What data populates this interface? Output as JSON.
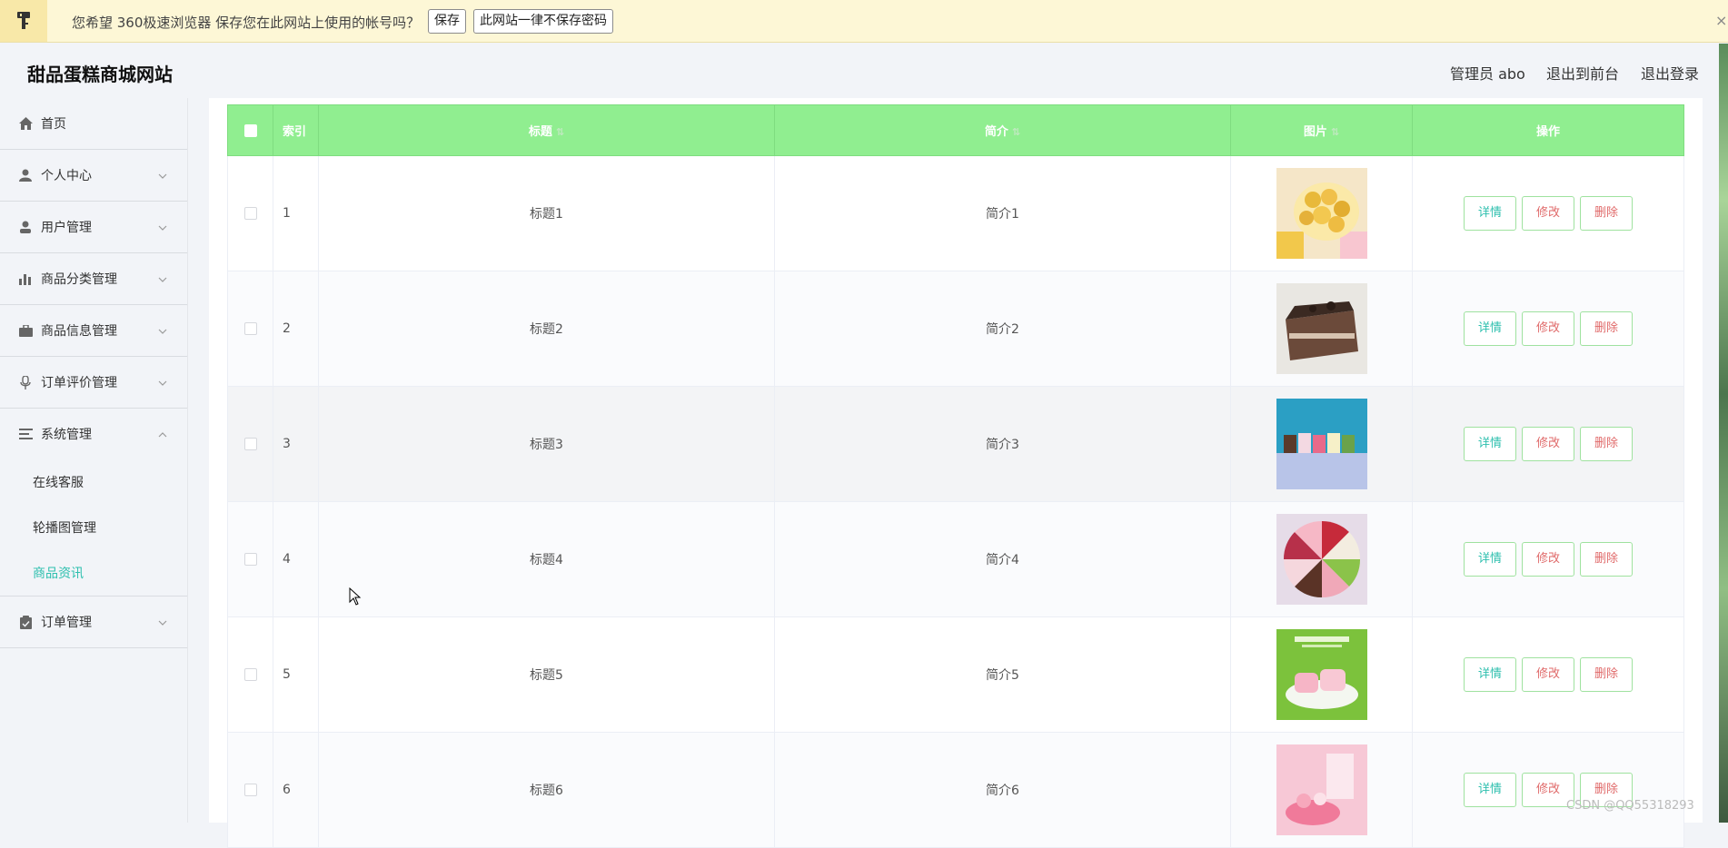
{
  "browser_bar": {
    "message": "您希望 360极速浏览器 保存您在此网站上使用的帐号吗？",
    "save_label": "保存",
    "never_label": "此网站一律不保存密码",
    "close_label": "×"
  },
  "header": {
    "title": "甜品蛋糕商城网站",
    "user_label": "管理员 abo",
    "back_label": "退出到前台",
    "logout_label": "退出登录"
  },
  "sidebar": {
    "items": [
      {
        "label": "首页",
        "icon": "home-icon"
      },
      {
        "label": "个人中心",
        "icon": "person-icon"
      },
      {
        "label": "用户管理",
        "icon": "user-icon"
      },
      {
        "label": "商品分类管理",
        "icon": "bar-chart-icon"
      },
      {
        "label": "商品信息管理",
        "icon": "briefcase-icon"
      },
      {
        "label": "订单评价管理",
        "icon": "mic-icon"
      },
      {
        "label": "系统管理",
        "icon": "list-icon"
      },
      {
        "label": "订单管理",
        "icon": "clipboard-icon"
      }
    ],
    "system_sub": [
      "在线客服",
      "轮播图管理",
      "商品资讯"
    ],
    "active_sub": "商品资讯"
  },
  "table": {
    "headers": {
      "index": "索引",
      "title": "标题",
      "intro": "简介",
      "image": "图片",
      "ops": "操作"
    },
    "rows": [
      {
        "index": "1",
        "title": "标题1",
        "intro": "简介1"
      },
      {
        "index": "2",
        "title": "标题2",
        "intro": "简介2"
      },
      {
        "index": "3",
        "title": "标题3",
        "intro": "简介3"
      },
      {
        "index": "4",
        "title": "标题4",
        "intro": "简介4"
      },
      {
        "index": "5",
        "title": "标题5",
        "intro": "简介5"
      },
      {
        "index": "6",
        "title": "标题6",
        "intro": "简介6"
      }
    ],
    "buttons": {
      "detail": "详情",
      "edit": "修改",
      "delete": "删除"
    }
  },
  "watermark": "CSDN @QQ55318293",
  "colors": {
    "table_header": "#90ee90",
    "accent": "#2dbfae",
    "danger_text": "#e06a6a"
  }
}
